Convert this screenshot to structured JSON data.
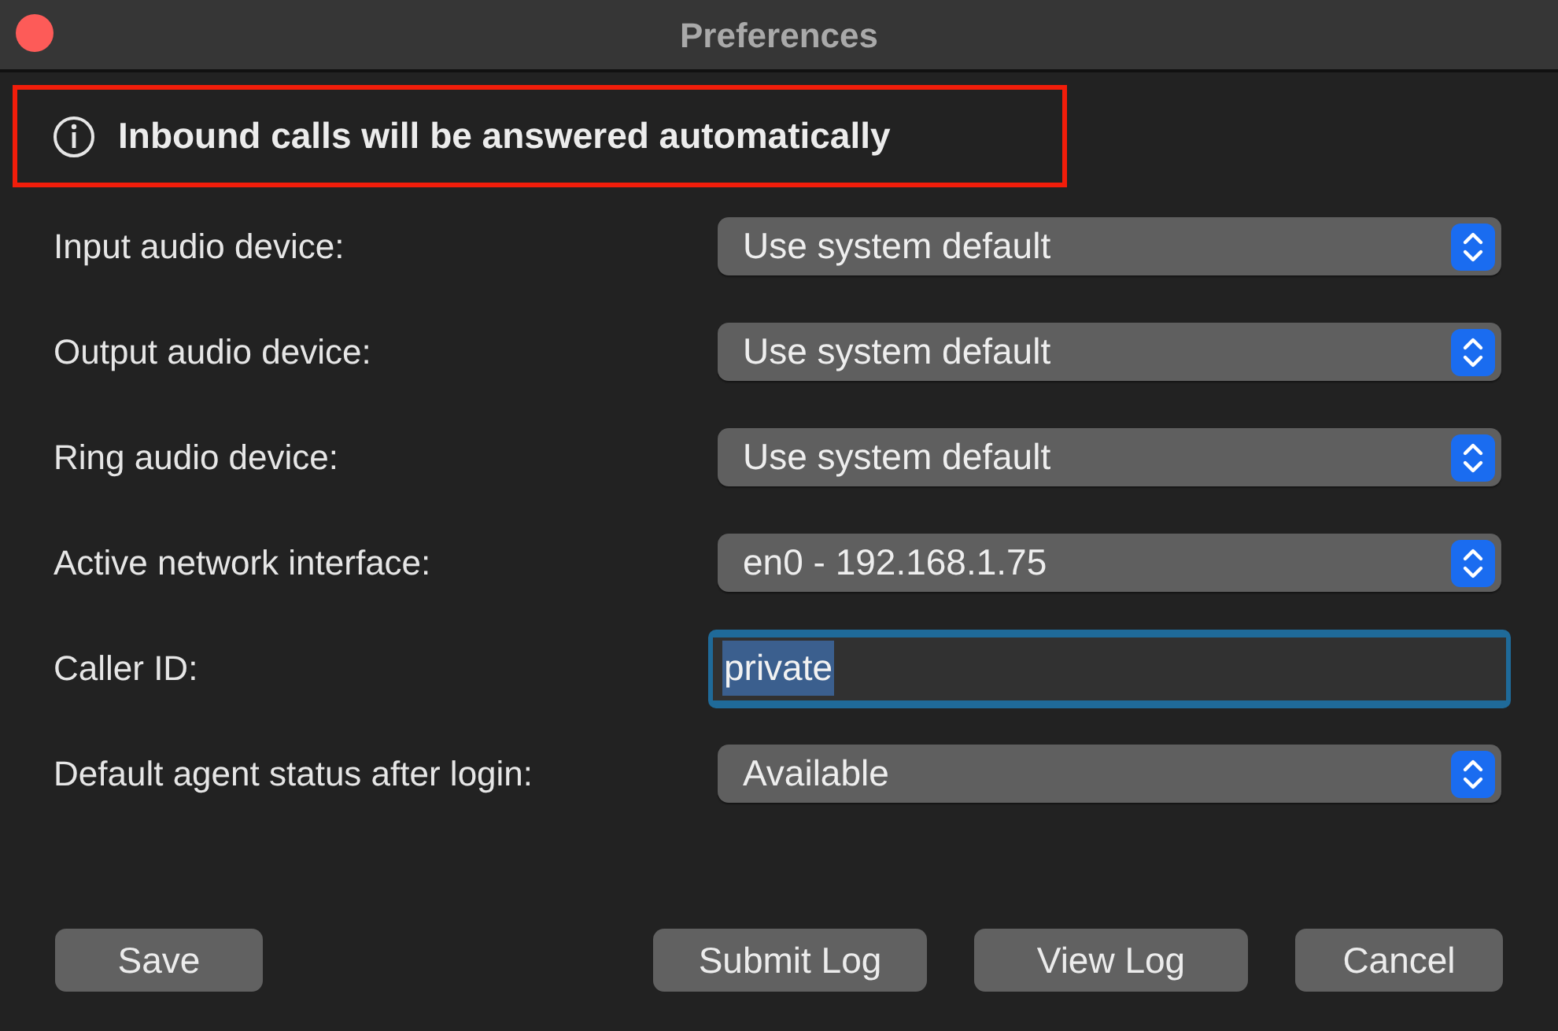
{
  "window": {
    "title": "Preferences"
  },
  "notice": {
    "text": "Inbound calls will be answered automatically",
    "highlighted": true
  },
  "fields": [
    {
      "kind": "select",
      "label": "Input audio device:",
      "value": "Use system default"
    },
    {
      "kind": "select",
      "label": "Output audio device:",
      "value": "Use system default"
    },
    {
      "kind": "select",
      "label": "Ring audio device:",
      "value": "Use system default"
    },
    {
      "kind": "select",
      "label": "Active network interface:",
      "value": "en0 - 192.168.1.75"
    },
    {
      "kind": "text",
      "label": "Caller ID:",
      "value": "private",
      "focused": true,
      "text_selected": true
    },
    {
      "kind": "select",
      "label": "Default agent status after login:",
      "value": "Available"
    }
  ],
  "buttons_left": [
    "Save"
  ],
  "buttons_right": [
    "Submit Log",
    "View Log",
    "Cancel"
  ]
}
